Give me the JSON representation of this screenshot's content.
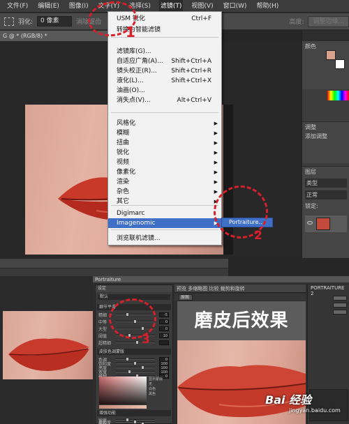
{
  "menubar": {
    "items": [
      "文件(F)",
      "编辑(E)",
      "图像(I)",
      "文字(Y)",
      "选择(S)",
      "滤镜(T)",
      "视图(V)",
      "窗口(W)",
      "帮助(H)"
    ],
    "active_index": 5
  },
  "options_bar": {
    "feather_label": "羽化:",
    "feather_value": "0 像素",
    "antialias": "消除锯齿",
    "height_label": "高度:",
    "refine_button": "调整边缘..."
  },
  "document_tab": "G @ * (RGB/8) *",
  "filter_menu": {
    "items": [
      {
        "label": "USM 锐化",
        "shortcut": "Ctrl+F"
      },
      {
        "label": "转换为智能滤镜",
        "shortcut": ""
      },
      {
        "label": "滤镜库(G)...",
        "shortcut": ""
      },
      {
        "label": "自适应广角(A)...",
        "shortcut": "Shift+Ctrl+A"
      },
      {
        "label": "镜头校正(R)...",
        "shortcut": "Shift+Ctrl+R"
      },
      {
        "label": "液化(L)...",
        "shortcut": "Shift+Ctrl+X"
      },
      {
        "label": "油画(O)...",
        "shortcut": ""
      },
      {
        "label": "消失点(V)...",
        "shortcut": "Alt+Ctrl+V"
      },
      {
        "label": "风格化",
        "shortcut": ""
      },
      {
        "label": "模糊",
        "shortcut": ""
      },
      {
        "label": "扭曲",
        "shortcut": ""
      },
      {
        "label": "锐化",
        "shortcut": ""
      },
      {
        "label": "视频",
        "shortcut": ""
      },
      {
        "label": "像素化",
        "shortcut": ""
      },
      {
        "label": "渲染",
        "shortcut": ""
      },
      {
        "label": "杂色",
        "shortcut": ""
      },
      {
        "label": "其它",
        "shortcut": ""
      },
      {
        "label": "Digimarc",
        "shortcut": ""
      },
      {
        "label": "Imagenomic",
        "shortcut": ""
      },
      {
        "label": "浏览联机滤镜...",
        "shortcut": ""
      }
    ],
    "submenu_item": "Portraiture..."
  },
  "right_panel": {
    "color_tab": "颜色",
    "adjust_tab": "调整",
    "add_adjust": "添加调整",
    "layers_tab": "图层",
    "kind": "类型",
    "normal": "正常",
    "lock": "锁定:"
  },
  "portraiture": {
    "window_title": "Portraiture",
    "panel_title": "PORTRAITURE 2",
    "toolbar_text": "预览    多缩略图    比较    裁剪和旋转",
    "tab": "原图",
    "left_header": "设定",
    "preset": "默认",
    "section1": "细节平滑",
    "section1_labels": [
      "精细",
      "中等",
      "大型",
      "阈值",
      "超精细"
    ],
    "section1_values": [
      "-5",
      "0",
      "0",
      "10",
      ""
    ],
    "section2": "皮肤色调蒙版",
    "section2_labels": [
      "色调",
      "饱和度",
      "亮度",
      "宽度",
      "模糊"
    ],
    "section2_values": [
      "0",
      "100",
      "100",
      "100",
      "0"
    ],
    "mask_options": [
      "显示蒙版",
      "无",
      "白色",
      "黑色"
    ],
    "section3": "增强功能",
    "section3_labels": [
      "锐度",
      "柔和度",
      "暖色"
    ]
  },
  "overlay_text": "磨皮后效果",
  "annotations": [
    "1",
    "2",
    "3"
  ],
  "watermark": {
    "brand": "Bai 经验",
    "url": "jingyan.baidu.com"
  }
}
